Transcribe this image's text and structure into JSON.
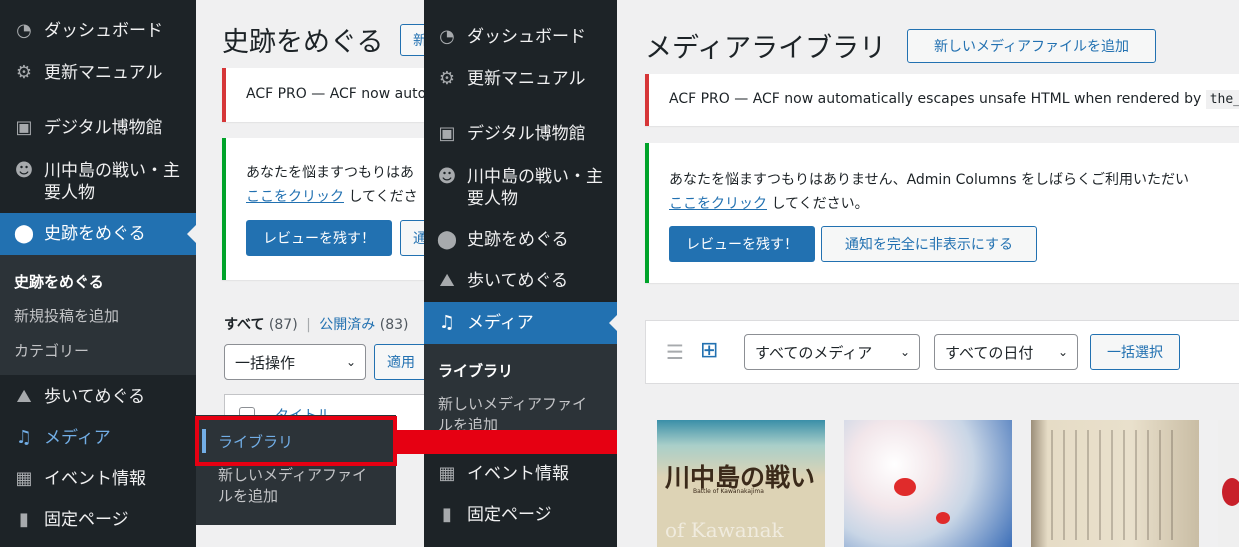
{
  "left_sidebar": {
    "items": [
      {
        "label": "ダッシュボード",
        "icon": "dashboard-icon"
      },
      {
        "label": "更新マニュアル",
        "icon": "gear-icon"
      },
      {
        "label": "デジタル博物館",
        "icon": "gallery-icon"
      },
      {
        "label": "川中島の戦い・主\n要人物",
        "icon": "groups-icon"
      },
      {
        "label": "史跡をめぐる",
        "icon": "location-pin-icon"
      },
      {
        "label": "歩いてめぐる",
        "icon": "map-icon"
      },
      {
        "label": "メディア",
        "icon": "media-icon"
      },
      {
        "label": "イベント情報",
        "icon": "calendar-icon"
      },
      {
        "label": "固定ページ",
        "icon": "page-icon"
      }
    ],
    "submenu": [
      "史跡をめぐる",
      "新規投稿を追加",
      "カテゴリー"
    ]
  },
  "left_content": {
    "title": "史跡をめぐる",
    "add_new_partial": "新",
    "acf_notice": "ACF PRO — ACF now auto",
    "review_notice_line1": "あなたを悩ますつもりはあ",
    "review_notice_link": "ここをクリック",
    "review_notice_line2_rest": " してくださ",
    "review_button": "レビューを残す！",
    "hide_button_partial": "通",
    "filter_all": "すべて",
    "filter_all_count": "(87)",
    "filter_separator": "|",
    "filter_published": "公開済み",
    "filter_published_count": "(83)",
    "bulk_action": "一括操作",
    "apply_button": "適用",
    "column_title": "タイトル"
  },
  "flyout": {
    "library": "ライブラリ",
    "add_new": "新しいメディアファイ\nルを追加"
  },
  "right_sidebar": {
    "items": [
      {
        "label": "ダッシュボード",
        "icon": "dashboard-icon"
      },
      {
        "label": "更新マニュアル",
        "icon": "gear-icon"
      },
      {
        "label": "デジタル博物館",
        "icon": "gallery-icon"
      },
      {
        "label": "川中島の戦い・主\n要人物",
        "icon": "groups-icon"
      },
      {
        "label": "史跡をめぐる",
        "icon": "location-pin-icon"
      },
      {
        "label": "歩いてめぐる",
        "icon": "map-icon"
      },
      {
        "label": "メディア",
        "icon": "media-icon"
      },
      {
        "label": "イベント情報",
        "icon": "calendar-icon"
      },
      {
        "label": "固定ページ",
        "icon": "page-icon"
      }
    ],
    "submenu": [
      "ライブラリ",
      "新しいメディアファイ\nルを追加"
    ]
  },
  "right_content": {
    "title": "メディアライブラリ",
    "add_new_button": "新しいメディアファイルを追加",
    "acf_notice_prefix": "ACF PRO — ACF now automatically escapes unsafe HTML when rendered by ",
    "acf_notice_code": "the_",
    "review_notice_line1": "あなたを悩ますつもりはありません、Admin Columns をしばらくご利用いただい",
    "review_notice_link": "ここをクリック",
    "review_notice_line2_rest": " してください。",
    "review_button": "レビューを残す！",
    "hide_button": "通知を完全に非表示にする",
    "filter_media": "すべてのメディア",
    "filter_date": "すべての日付",
    "bulk_select": "一括選択",
    "thumb1_text": "川中島の戦い",
    "thumb1_subtitle": "Battle of Kawanakajima",
    "thumb1_watermark": "of Kawanak"
  },
  "colors": {
    "sidebar_bg": "#1d2327",
    "accent_blue": "#2271b1",
    "highlight_red": "#e60012",
    "notice_red": "#d63638",
    "notice_green": "#00a32a"
  }
}
